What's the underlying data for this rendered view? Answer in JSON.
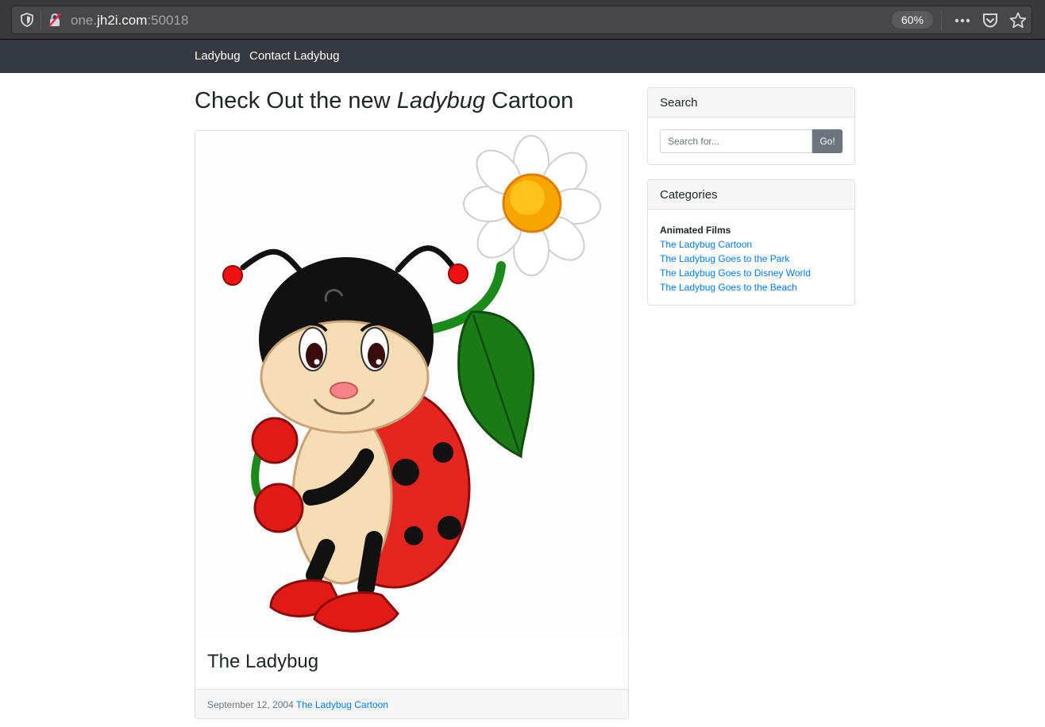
{
  "browser": {
    "url_prefix": "one.",
    "url_host": "jh2i.com",
    "url_suffix": ":50018",
    "zoom": "60%"
  },
  "nav": {
    "brand": "Ladybug",
    "contact": "Contact Ladybug"
  },
  "main": {
    "title_before": "Check Out the new ",
    "title_em": "Ladybug",
    "title_after": " Cartoon",
    "card": {
      "title": "The Ladybug",
      "date": "September 12, 2004",
      "category_link": "The Ladybug Cartoon"
    }
  },
  "sidebar": {
    "search": {
      "header": "Search",
      "placeholder": "Search for...",
      "button": "Go!"
    },
    "categories": {
      "header": "Categories",
      "group": "Animated Films",
      "links": [
        "The Ladybug Cartoon",
        "The Ladybug Goes to the Park",
        "The Ladybug Goes to Disney World",
        "The Ladybug Goes to the Beach"
      ]
    }
  },
  "colors": {
    "navbar": "#343a40",
    "link": "#007bff",
    "button": "#6c757d"
  }
}
